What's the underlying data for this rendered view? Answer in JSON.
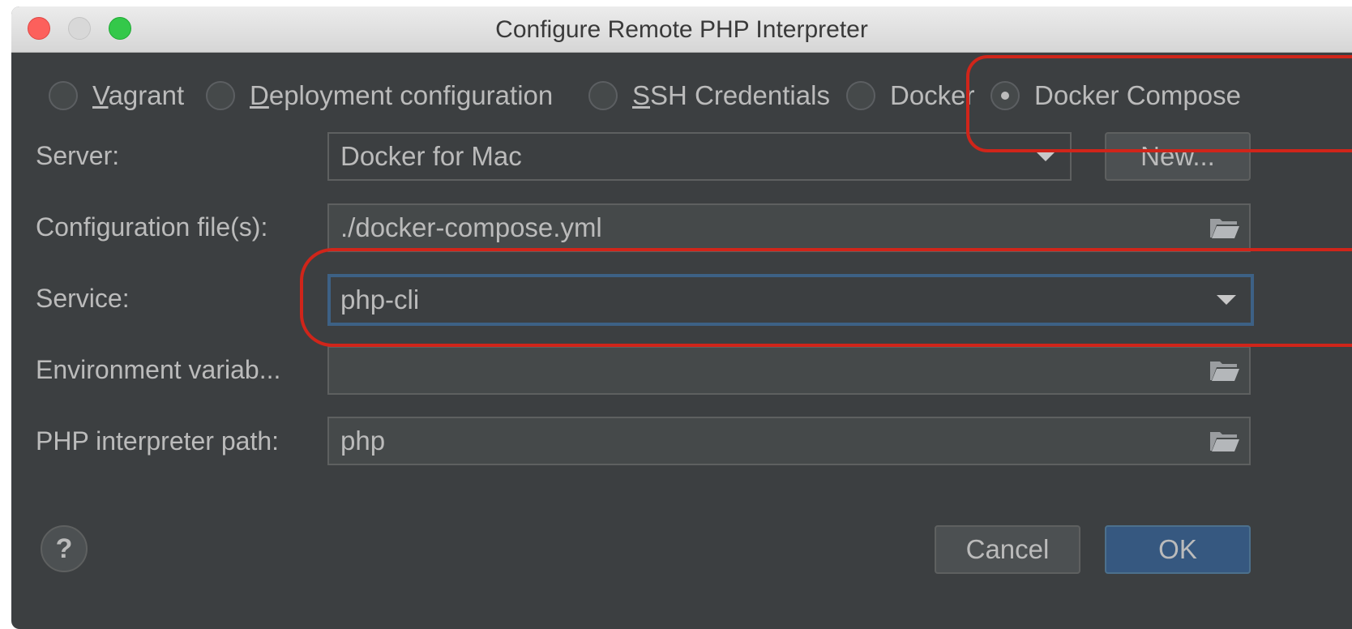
{
  "window": {
    "title": "Configure Remote PHP Interpreter"
  },
  "radio_options": [
    {
      "pre": "",
      "mnemonic": "V",
      "post": "agrant",
      "selected": false
    },
    {
      "pre": "",
      "mnemonic": "D",
      "post": "eployment configuration",
      "selected": false
    },
    {
      "pre": "",
      "mnemonic": "S",
      "post": "SH Credentials",
      "selected": false
    },
    {
      "pre": "Docker",
      "mnemonic": "",
      "post": "",
      "selected": false
    },
    {
      "pre": "Docker Compose",
      "mnemonic": "",
      "post": "",
      "selected": true
    }
  ],
  "form": {
    "server_label": "Server:",
    "server_value": "Docker for Mac",
    "new_button": "New...",
    "config_label": "Configuration file(s):",
    "config_value": "./docker-compose.yml",
    "service_label": "Service:",
    "service_value": "php-cli",
    "env_label": "Environment variab...",
    "env_value": "",
    "php_path_label": "PHP interpreter path:",
    "php_path_value": "php"
  },
  "footer": {
    "help": "?",
    "cancel": "Cancel",
    "ok": "OK"
  },
  "colors": {
    "dialog_bg": "#3c3f41",
    "field_bg": "#45494a",
    "focus_border": "#3d6185",
    "primary_button": "#365880",
    "annotation": "#d0251a"
  },
  "icons": {
    "dropdown": "chevron-down-icon",
    "browse": "folder-icon",
    "help": "help-icon"
  }
}
